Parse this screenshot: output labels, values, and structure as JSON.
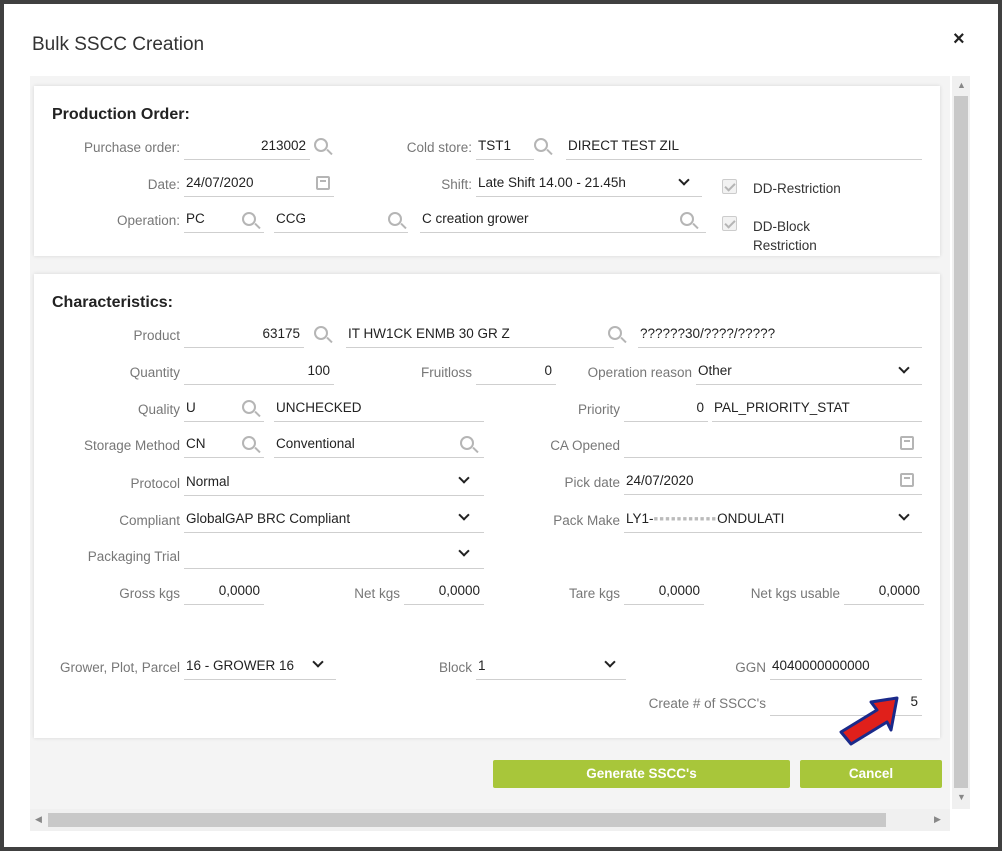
{
  "dialog": {
    "title": "Bulk SSCC Creation",
    "close": "×"
  },
  "production": {
    "heading": "Production Order:",
    "purchase_order_label": "Purchase order:",
    "purchase_order_value": "213002",
    "cold_store_label": "Cold store:",
    "cold_store_code": "TST1",
    "cold_store_name": "DIRECT TEST ZIL",
    "date_label": "Date:",
    "date_value": "24/07/2020",
    "shift_label": "Shift:",
    "shift_value": "Late Shift 14.00 - 21.45h",
    "dd_restriction_label": "DD-Restriction",
    "operation_label": "Operation:",
    "operation_code": "PC",
    "operation_sub": "CCG",
    "operation_name": "C creation grower",
    "dd_block_label": "DD-Block Restriction"
  },
  "characteristics": {
    "heading": "Characteristics:",
    "product_label": "Product",
    "product_code": "63175",
    "product_name": "IT HW1CK ENMB 30 GR Z",
    "product_extra": "??????30/????/?????",
    "quantity_label": "Quantity",
    "quantity_value": "100",
    "fruitloss_label": "Fruitloss",
    "fruitloss_value": "0",
    "operation_reason_label": "Operation reason",
    "operation_reason_value": "Other",
    "quality_label": "Quality",
    "quality_code": "U",
    "quality_name": "UNCHECKED",
    "priority_label": "Priority",
    "priority_value": "0",
    "priority_name": "PAL_PRIORITY_STAT",
    "storage_label": "Storage Method",
    "storage_code": "CN",
    "storage_name": "Conventional",
    "ca_opened_label": "CA Opened",
    "protocol_label": "Protocol",
    "protocol_value": "Normal",
    "pick_date_label": "Pick date",
    "pick_date_value": "24/07/2020",
    "compliant_label": "Compliant",
    "compliant_value": "GlobalGAP BRC Compliant",
    "pack_make_label": "Pack Make",
    "pack_make_prefix": "LY1-",
    "pack_make_suffix": "ONDULATI",
    "packaging_trial_label": "Packaging Trial",
    "gross_label": "Gross kgs",
    "gross_value": "0,0000",
    "net_label": "Net kgs",
    "net_value": "0,0000",
    "tare_label": "Tare kgs",
    "tare_value": "0,0000",
    "net_usable_label": "Net kgs usable",
    "net_usable_value": "0,0000",
    "grower_label": "Grower, Plot, Parcel",
    "grower_value": "16 - GROWER 16",
    "block_label": "Block",
    "block_value": "1",
    "ggn_label": "GGN",
    "ggn_value": "4040000000000",
    "create_label": "Create # of SSCC's",
    "create_value": "5"
  },
  "buttons": {
    "generate": "Generate SSCC's",
    "cancel": "Cancel"
  },
  "colors": {
    "accent": "#a8c63a",
    "annotation_arrow": "#e0201b"
  },
  "icons": [
    "search-icon",
    "calendar-icon",
    "chevron-down-icon",
    "checkbox-icon",
    "close-icon"
  ]
}
